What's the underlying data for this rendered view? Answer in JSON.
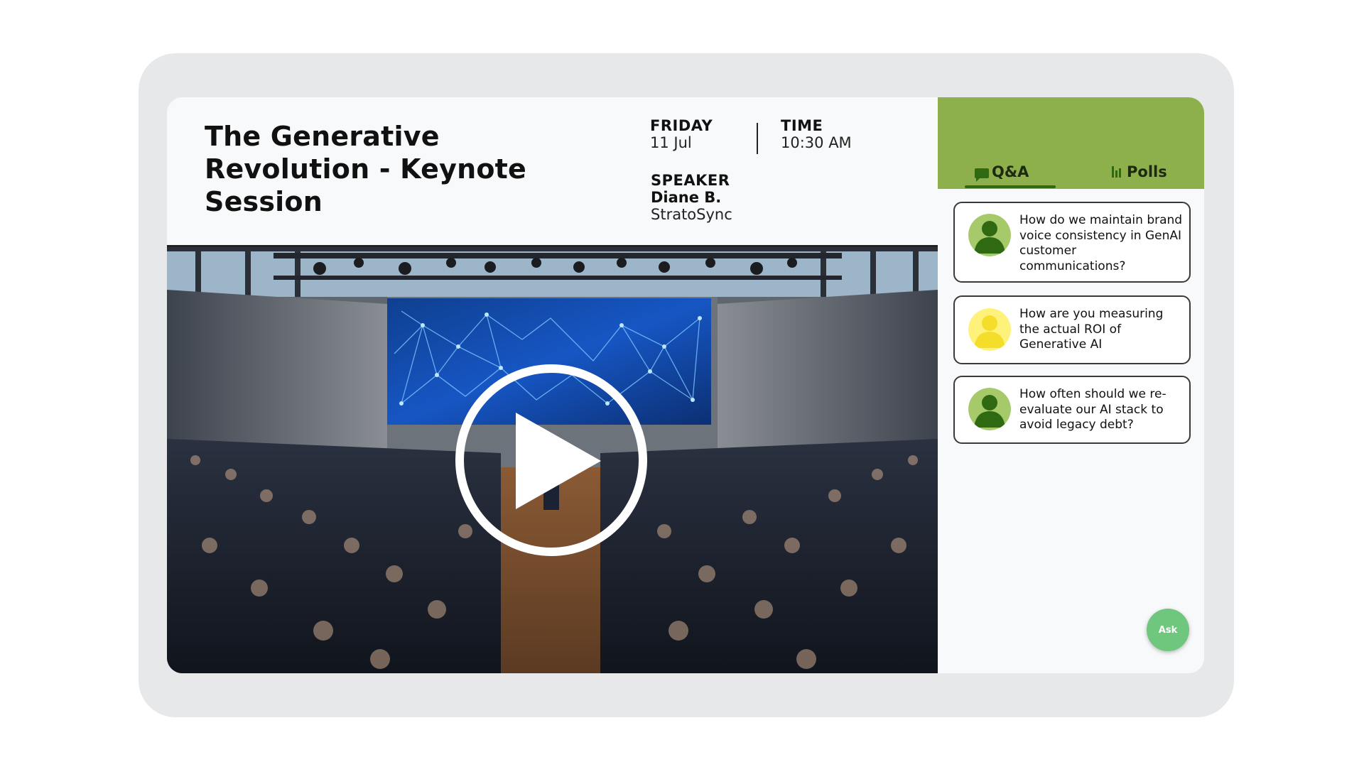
{
  "session": {
    "title": "The Generative Revolution - Keynote Session",
    "day_label": "FRIDAY",
    "date": "11 Jul",
    "time_label": "TIME",
    "time": "10:30 AM",
    "speaker_label": "SPEAKER",
    "speaker_name": "Diane B.",
    "speaker_company": "StratoSync"
  },
  "video": {
    "play_icon": "play-icon"
  },
  "sidebar": {
    "tabs": [
      {
        "label": "Q&A",
        "icon": "chat-icon",
        "active": true
      },
      {
        "label": "Polls",
        "icon": "bar-chart-icon",
        "active": false
      }
    ],
    "questions": [
      {
        "text": "How do we maintain brand voice consistency in GenAI customer communications?",
        "avatar_color": "#2f6a13",
        "avatar_bg": "#a6c96a"
      },
      {
        "text": "How are you measuring the actual ROI of Generative AI",
        "avatar_color": "#f5de2a",
        "avatar_bg": "#fff27a"
      },
      {
        "text": "How often should we re-evaluate our AI stack to avoid legacy debt?",
        "avatar_color": "#2f6a13",
        "avatar_bg": "#a6c96a"
      }
    ],
    "ask_label": "Ask"
  },
  "colors": {
    "accent_green": "#8db04c",
    "dark_green": "#2f6a13",
    "ask_button": "#6ec77d"
  }
}
